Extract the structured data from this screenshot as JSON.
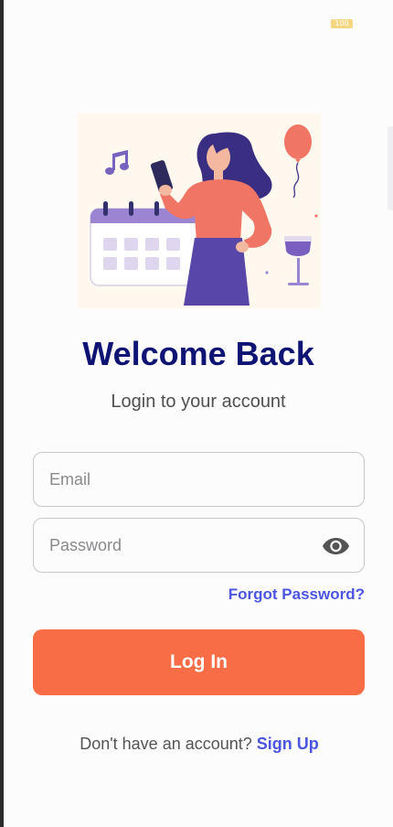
{
  "status_bar": {
    "battery_level": "100"
  },
  "header": {
    "title": "Welcome Back",
    "subtitle": "Login to your account"
  },
  "form": {
    "email": {
      "placeholder": "Email",
      "value": ""
    },
    "password": {
      "placeholder": "Password",
      "value": ""
    },
    "password_toggle_icon": "eye-icon",
    "forgot_password_label": "Forgot Password?",
    "login_label": "Log In"
  },
  "signup": {
    "prompt": "Don't have an account?",
    "link_label": "Sign Up"
  },
  "colors": {
    "title": "#0e1473",
    "accent_button": "#f86d46",
    "link": "#4a56e2",
    "illustration_bg": "#fff8ef"
  },
  "illustration": {
    "description_icon": "woman-phone-calendar-illustration"
  }
}
